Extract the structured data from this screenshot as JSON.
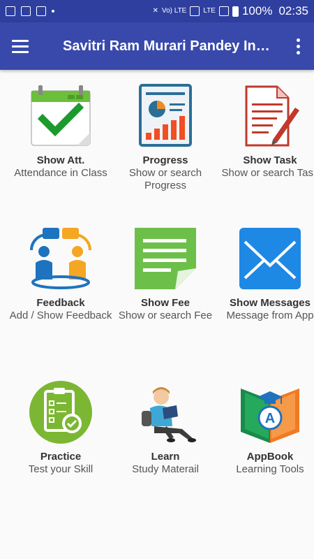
{
  "status_bar": {
    "signal_label": "LTE",
    "volte_label": "Vo) LTE",
    "battery": "100%",
    "time": "02:35"
  },
  "app_bar": {
    "title": "Savitri Ram Murari Pandey Inter..."
  },
  "tiles": [
    {
      "title": "Show Att.",
      "subtitle": "Attendance in Class",
      "icon": "calendar-check-icon"
    },
    {
      "title": "Progress",
      "subtitle": "Show or search Progress",
      "icon": "report-chart-icon"
    },
    {
      "title": "Show Task",
      "subtitle": "Show or search Task",
      "icon": "task-document-icon"
    },
    {
      "title": "Feedback",
      "subtitle": "Add / Show Feedback",
      "icon": "people-chat-icon"
    },
    {
      "title": "Show Fee",
      "subtitle": "Show or search Fee",
      "icon": "fee-document-icon"
    },
    {
      "title": "Show Messages",
      "subtitle": "Message from App",
      "icon": "envelope-icon"
    },
    {
      "title": "Practice",
      "subtitle": "Test your Skill",
      "icon": "clipboard-check-icon"
    },
    {
      "title": "Learn",
      "subtitle": "Study Materail",
      "icon": "student-reading-icon"
    },
    {
      "title": "AppBook",
      "subtitle": "Learning Tools",
      "icon": "book-graduation-icon"
    }
  ],
  "colors": {
    "status_bar": "#2f3f9f",
    "app_bar": "#3949ab",
    "background": "#fafafa"
  }
}
